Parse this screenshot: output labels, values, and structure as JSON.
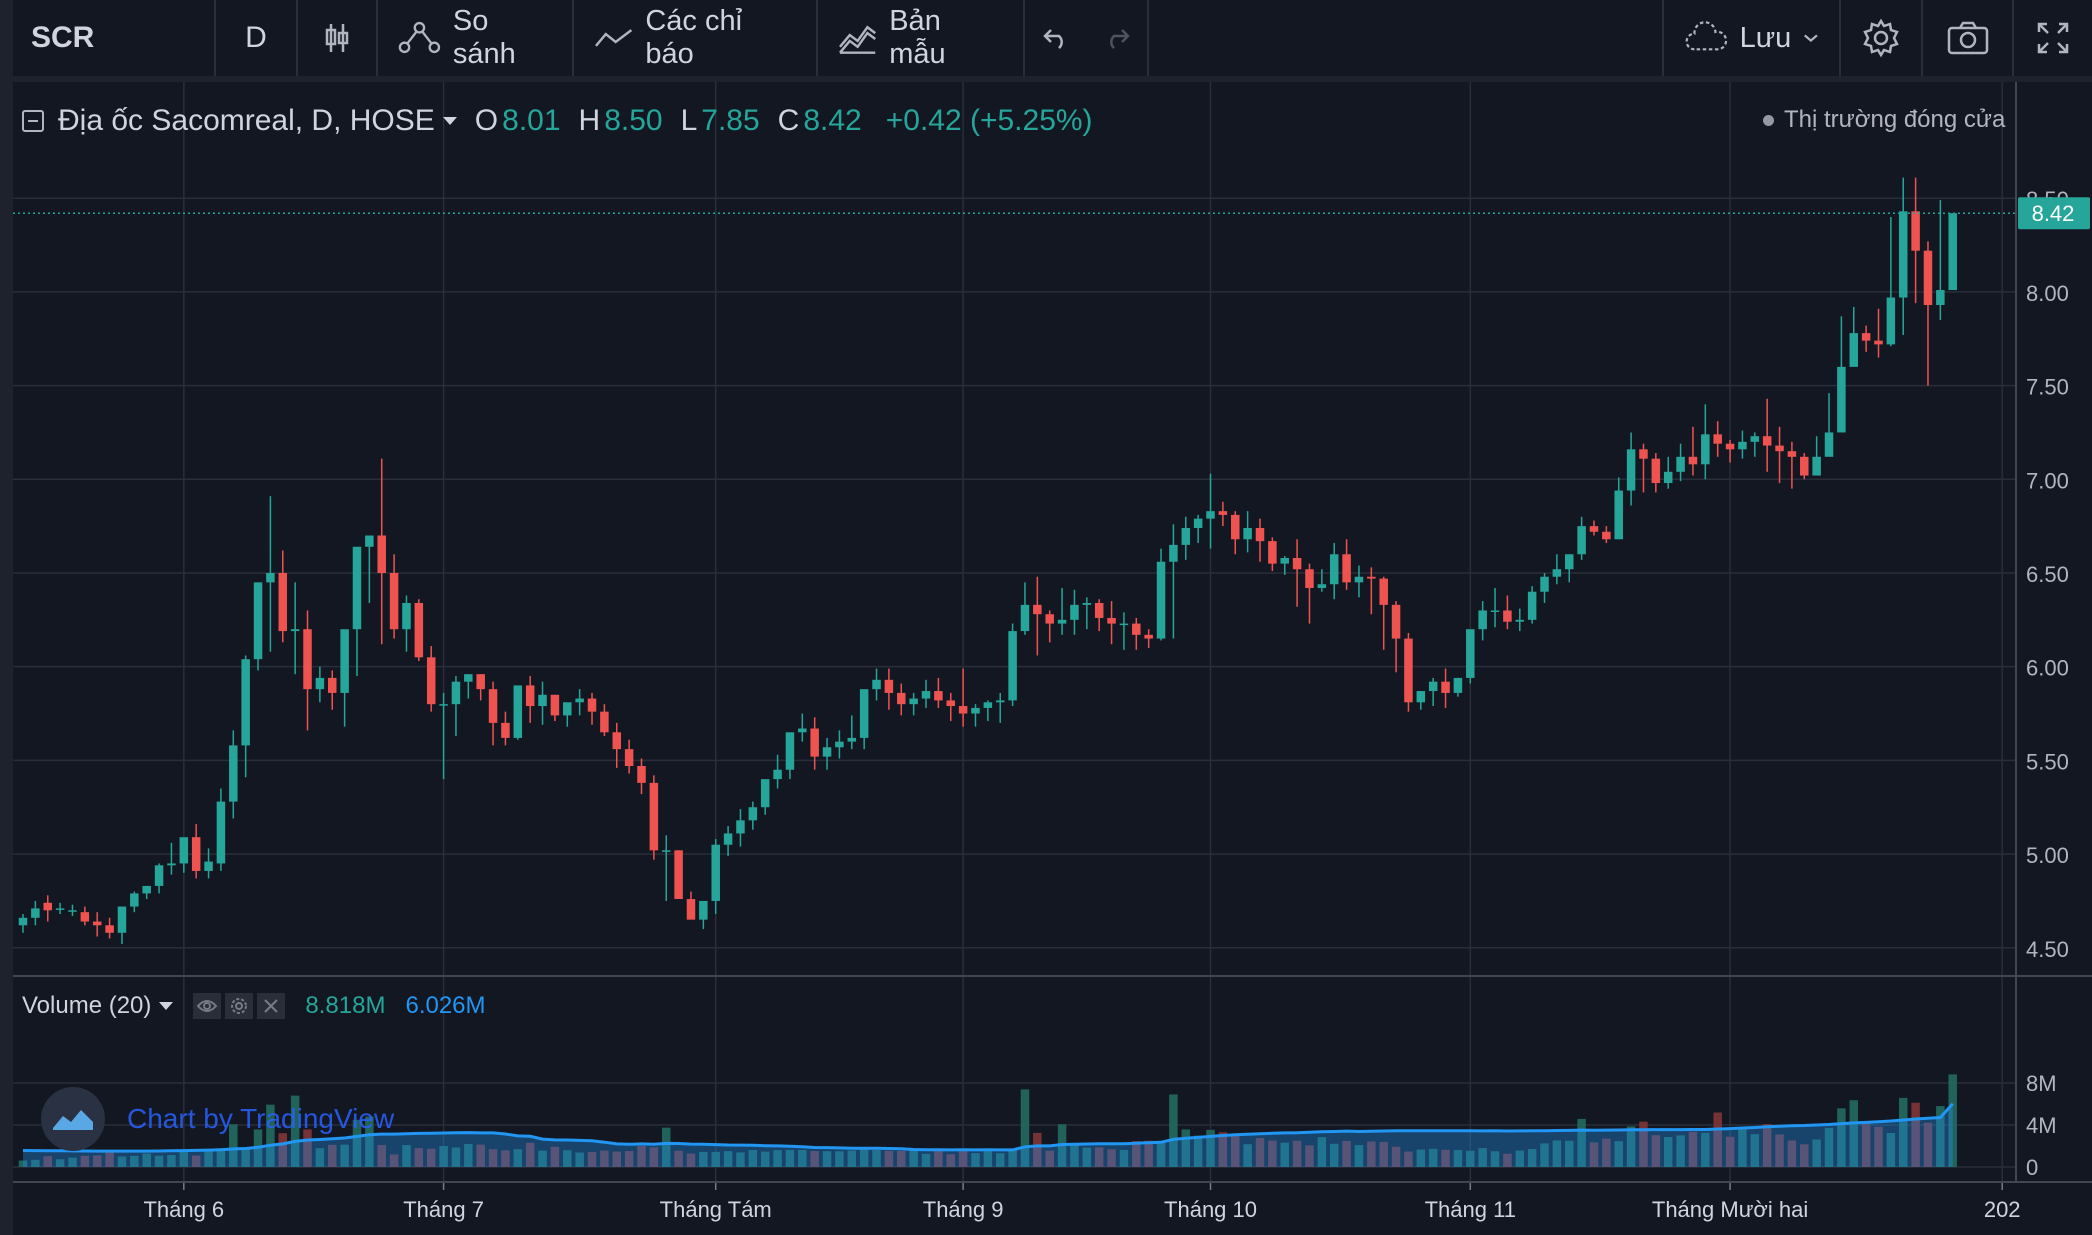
{
  "toolbar": {
    "symbol": "SCR",
    "timeframe": "D",
    "compare_label": "So sánh",
    "indicators_label": "Các chỉ báo",
    "templates_label": "Bản mẫu",
    "save_label": "Lưu",
    "icons": [
      "candles-icon",
      "compare-icon",
      "indicators-icon",
      "templates-icon",
      "undo-icon",
      "redo-icon",
      "cloud-icon",
      "chevron-down-icon",
      "gear-icon",
      "camera-icon",
      "fullscreen-icon"
    ]
  },
  "legend": {
    "title": "Địa ốc Sacomreal, D, HOSE",
    "open_label": "O",
    "open": "8.01",
    "high_label": "H",
    "high": "8.50",
    "low_label": "L",
    "low": "7.85",
    "close_label": "C",
    "close": "8.42",
    "change": "+0.42 (+5.25%)"
  },
  "market_status": "Thị trường đóng cửa",
  "volume_legend": {
    "title": "Volume (20)",
    "value": "8.818M",
    "ma_value": "6.026M"
  },
  "watermark": "Chart by TradingView",
  "colors": {
    "up": "#26a69a",
    "down": "#ef5350",
    "up_vol": "#22675e",
    "down_vol": "#7b3437",
    "ma_line": "#2196f3",
    "background": "#131722",
    "grid": "#2a2e39"
  },
  "chart_data": {
    "type": "candlestick",
    "last_price_label": "8.42",
    "price_ticks": [
      "4.50",
      "5.00",
      "5.50",
      "6.00",
      "6.50",
      "7.00",
      "7.50",
      "8.00",
      "8.50"
    ],
    "volume_ticks": [
      "0",
      "4M",
      "8M"
    ],
    "ylim": [
      4.36,
      8.8
    ],
    "vol_max": 10000000,
    "x_labels": [
      {
        "label": "Tháng 6",
        "index": 13
      },
      {
        "label": "Tháng 7",
        "index": 34
      },
      {
        "label": "Tháng Tám",
        "index": 56
      },
      {
        "label": "Tháng 9",
        "index": 76
      },
      {
        "label": "Tháng 10",
        "index": 96
      },
      {
        "label": "Tháng 11",
        "index": 117
      },
      {
        "label": "Tháng Mười hai",
        "index": 138
      },
      {
        "label": "202",
        "index": 160
      }
    ],
    "series": [
      {
        "name": "Địa ốc Sacomreal",
        "o": [
          4.62,
          4.66,
          4.74,
          4.71,
          4.7,
          4.69,
          4.64,
          4.62,
          4.58,
          4.72,
          4.79,
          4.83,
          4.94,
          4.95,
          5.09,
          4.91,
          4.95,
          5.28,
          5.58,
          6.04,
          6.45,
          6.5,
          6.19,
          6.2,
          5.88,
          5.94,
          5.86,
          6.2,
          6.64,
          6.7,
          6.5,
          6.2,
          6.34,
          6.05,
          5.8,
          5.8,
          5.92,
          5.96,
          5.88,
          5.7,
          5.62,
          5.9,
          5.79,
          5.85,
          5.74,
          5.81,
          5.83,
          5.76,
          5.65,
          5.56,
          5.47,
          5.38,
          5.02,
          5.02,
          4.76,
          4.65,
          4.75,
          5.05,
          5.11,
          5.18,
          5.25,
          5.4,
          5.45,
          5.65,
          5.67,
          5.52,
          5.57,
          5.6,
          5.62,
          5.88,
          5.93,
          5.86,
          5.8,
          5.83,
          5.87,
          5.82,
          5.79,
          5.75,
          5.78,
          5.81,
          5.82,
          6.19,
          6.33,
          6.28,
          6.23,
          6.25,
          6.33,
          6.34,
          6.26,
          6.23,
          6.23,
          6.17,
          6.15,
          6.56,
          6.65,
          6.74,
          6.79,
          6.83,
          6.81,
          6.68,
          6.74,
          6.67,
          6.55,
          6.58,
          6.52,
          6.42,
          6.44,
          6.6,
          6.45,
          6.48,
          6.47,
          6.33,
          6.15,
          5.81,
          5.87,
          5.92,
          5.86,
          5.94,
          6.2,
          6.3,
          6.3,
          6.24,
          6.25,
          6.4,
          6.48,
          6.52,
          6.6,
          6.75,
          6.72,
          6.68,
          6.94,
          7.16,
          7.11,
          6.98,
          7.04,
          7.12,
          7.08,
          7.24,
          7.19,
          7.16,
          7.2,
          7.23,
          7.18,
          7.15,
          7.12,
          7.02,
          7.12,
          7.25,
          7.6,
          7.78,
          7.74,
          7.72,
          7.97,
          8.43,
          8.22,
          7.93,
          8.01
        ],
        "h": [
          4.68,
          4.75,
          4.78,
          4.74,
          4.73,
          4.72,
          4.69,
          4.66,
          4.63,
          4.8,
          4.82,
          4.95,
          5.06,
          5.06,
          5.16,
          5.03,
          5.35,
          5.66,
          6.06,
          6.45,
          6.91,
          6.62,
          6.45,
          6.3,
          6.0,
          5.98,
          5.92,
          6.3,
          6.7,
          7.11,
          6.6,
          6.38,
          6.36,
          6.11,
          5.86,
          5.95,
          5.96,
          5.96,
          5.92,
          5.76,
          5.71,
          5.95,
          5.92,
          5.85,
          5.8,
          5.88,
          5.86,
          5.8,
          5.7,
          5.61,
          5.51,
          5.42,
          5.1,
          5.02,
          4.8,
          4.7,
          5.08,
          5.15,
          5.24,
          5.28,
          5.39,
          5.53,
          5.58,
          5.75,
          5.73,
          5.62,
          5.66,
          5.74,
          5.85,
          5.99,
          5.99,
          5.91,
          5.86,
          5.93,
          5.94,
          5.86,
          5.99,
          5.8,
          5.82,
          5.86,
          6.23,
          6.45,
          6.48,
          6.3,
          6.42,
          6.41,
          6.37,
          6.36,
          6.35,
          6.29,
          6.26,
          6.2,
          6.63,
          6.76,
          6.8,
          6.81,
          7.03,
          6.88,
          6.83,
          6.83,
          6.79,
          6.69,
          6.59,
          6.68,
          6.55,
          6.52,
          6.66,
          6.68,
          6.54,
          6.53,
          6.48,
          6.35,
          6.18,
          5.87,
          5.94,
          5.99,
          5.94,
          6.09,
          6.35,
          6.42,
          6.38,
          6.31,
          6.43,
          6.5,
          6.6,
          6.6,
          6.8,
          6.78,
          6.75,
          7.01,
          7.25,
          7.19,
          7.14,
          7.12,
          7.19,
          7.28,
          7.4,
          7.31,
          7.21,
          7.26,
          7.25,
          7.43,
          7.28,
          7.2,
          7.14,
          7.23,
          7.46,
          7.87,
          7.92,
          7.82,
          7.91,
          8.4,
          8.61,
          8.61,
          8.27,
          8.49
        ],
        "l": [
          4.58,
          4.62,
          4.64,
          4.68,
          4.67,
          4.62,
          4.56,
          4.55,
          4.52,
          4.69,
          4.76,
          4.79,
          4.89,
          4.9,
          4.87,
          4.87,
          4.91,
          5.19,
          5.41,
          5.98,
          6.08,
          6.13,
          5.96,
          5.66,
          5.81,
          5.77,
          5.68,
          5.95,
          6.34,
          6.12,
          6.15,
          6.08,
          6.03,
          5.76,
          5.4,
          5.63,
          5.83,
          5.82,
          5.58,
          5.58,
          5.61,
          5.7,
          5.69,
          5.71,
          5.68,
          5.74,
          5.69,
          5.63,
          5.46,
          5.43,
          5.32,
          4.97,
          4.75,
          4.98,
          4.67,
          4.6,
          4.68,
          4.99,
          5.04,
          5.13,
          5.21,
          5.35,
          5.4,
          5.6,
          5.45,
          5.45,
          5.51,
          5.56,
          5.56,
          5.82,
          5.77,
          5.74,
          5.74,
          5.78,
          5.78,
          5.71,
          5.68,
          5.68,
          5.71,
          5.7,
          5.79,
          6.17,
          6.06,
          6.13,
          6.17,
          6.17,
          6.2,
          6.19,
          6.12,
          6.09,
          6.09,
          6.1,
          6.14,
          6.15,
          6.57,
          6.66,
          6.63,
          6.75,
          6.6,
          6.61,
          6.56,
          6.51,
          6.49,
          6.32,
          6.23,
          6.4,
          6.36,
          6.41,
          6.37,
          6.28,
          6.09,
          5.97,
          5.76,
          5.77,
          5.79,
          5.78,
          5.84,
          5.91,
          6.14,
          6.21,
          6.2,
          6.19,
          6.23,
          6.34,
          6.44,
          6.45,
          6.57,
          6.7,
          6.66,
          6.68,
          6.86,
          6.93,
          6.93,
          6.95,
          6.99,
          7.02,
          7.0,
          7.12,
          7.09,
          7.11,
          7.12,
          7.04,
          6.98,
          6.95,
          7.0,
          7.1,
          7.23,
          7.48,
          7.62,
          7.68,
          7.65,
          7.71,
          7.77,
          7.94,
          7.5,
          7.85
        ],
        "c": [
          4.66,
          4.71,
          4.7,
          4.71,
          4.7,
          4.64,
          4.62,
          4.58,
          4.72,
          4.79,
          4.83,
          4.94,
          4.95,
          5.09,
          4.91,
          4.96,
          5.28,
          5.58,
          6.04,
          6.45,
          6.5,
          6.19,
          6.2,
          5.88,
          5.94,
          5.86,
          6.2,
          6.64,
          6.7,
          6.5,
          6.2,
          6.34,
          6.05,
          5.8,
          5.8,
          5.92,
          5.96,
          5.88,
          5.7,
          5.62,
          5.9,
          5.79,
          5.85,
          5.74,
          5.81,
          5.83,
          5.76,
          5.65,
          5.56,
          5.47,
          5.38,
          5.02,
          5.02,
          4.76,
          4.65,
          4.75,
          5.05,
          5.11,
          5.18,
          5.25,
          5.4,
          5.45,
          5.65,
          5.67,
          5.52,
          5.57,
          5.6,
          5.62,
          5.88,
          5.93,
          5.86,
          5.8,
          5.83,
          5.87,
          5.82,
          5.79,
          5.75,
          5.78,
          5.81,
          5.82,
          6.19,
          6.33,
          6.28,
          6.23,
          6.25,
          6.33,
          6.34,
          6.26,
          6.23,
          6.23,
          6.17,
          6.15,
          6.56,
          6.65,
          6.74,
          6.79,
          6.83,
          6.81,
          6.68,
          6.74,
          6.67,
          6.55,
          6.58,
          6.52,
          6.42,
          6.44,
          6.6,
          6.45,
          6.48,
          6.47,
          6.33,
          6.15,
          5.81,
          5.87,
          5.92,
          5.86,
          5.94,
          6.2,
          6.3,
          6.3,
          6.24,
          6.25,
          6.4,
          6.48,
          6.52,
          6.6,
          6.75,
          6.72,
          6.68,
          6.94,
          7.16,
          7.11,
          6.98,
          7.04,
          7.12,
          7.08,
          7.24,
          7.19,
          7.16,
          7.2,
          7.23,
          7.18,
          7.15,
          7.12,
          7.02,
          7.12,
          7.25,
          7.6,
          7.78,
          7.74,
          7.72,
          7.97,
          8.43,
          8.22,
          7.93,
          8.01,
          8.42
        ],
        "v": [
          620000,
          680000,
          1030000,
          740000,
          890000,
          1070000,
          1110000,
          1550000,
          1000000,
          1060000,
          1280000,
          1080000,
          1140000,
          1450000,
          1090000,
          1600000,
          1790000,
          4070000,
          1700000,
          3580000,
          5940000,
          3220000,
          6800000,
          3580000,
          1790000,
          2110000,
          2130000,
          4490000,
          4810000,
          2090000,
          1200000,
          2090000,
          1800000,
          1740000,
          2000000,
          1860000,
          2190000,
          2130000,
          1700000,
          1590000,
          1700000,
          2310000,
          1560000,
          1920000,
          1600000,
          1380000,
          1430000,
          1570000,
          1470000,
          1520000,
          2000000,
          1880000,
          3750000,
          1550000,
          1280000,
          1440000,
          1440000,
          1510000,
          1390000,
          1620000,
          1470000,
          1610000,
          1630000,
          1620000,
          1520000,
          1510000,
          1500000,
          1560000,
          1710000,
          1610000,
          1540000,
          1530000,
          1620000,
          1260000,
          1600000,
          1220000,
          1660000,
          1330000,
          1590000,
          1310000,
          1760000,
          7390000,
          3250000,
          1550000,
          4070000,
          2190000,
          1850000,
          1870000,
          1690000,
          1630000,
          2470000,
          2500000,
          2380000,
          6910000,
          3580000,
          2990000,
          3540000,
          3310000,
          3000000,
          2170000,
          2750000,
          2510000,
          2320000,
          2500000,
          2060000,
          2850000,
          2210000,
          2480000,
          2090000,
          2430000,
          2390000,
          1930000,
          1470000,
          1660000,
          1730000,
          1640000,
          1620000,
          1540000,
          1800000,
          1500000,
          1260000,
          1560000,
          1710000,
          2250000,
          2530000,
          2500000,
          4580000,
          2350000,
          2700000,
          2460000,
          3870000,
          4320000,
          3030000,
          2860000,
          3010000,
          3360000,
          3260000,
          5190000,
          2880000,
          3600000,
          3130000,
          4090000,
          3100000,
          2530000,
          2160000,
          2620000,
          3730000,
          5590000,
          6360000,
          4140000,
          3830000,
          3240000,
          6580000,
          6120000,
          4220000,
          5800000,
          8818000
        ],
        "ma": [
          1570000,
          1560000,
          1550000,
          1540000,
          1530000,
          1520000,
          1510000,
          1510000,
          1510000,
          1510000,
          1510000,
          1520000,
          1540000,
          1560000,
          1580000,
          1610000,
          1640000,
          1720000,
          1760000,
          1880000,
          2080000,
          2200000,
          2440000,
          2570000,
          2620000,
          2690000,
          2760000,
          2910000,
          3070000,
          3130000,
          3130000,
          3170000,
          3200000,
          3220000,
          3240000,
          3260000,
          3280000,
          3250000,
          3250000,
          3140000,
          2960000,
          2920000,
          2660000,
          2580000,
          2570000,
          2530000,
          2500000,
          2360000,
          2200000,
          2160000,
          2200000,
          2170000,
          2250000,
          2240000,
          2180000,
          2160000,
          2130000,
          2100000,
          2090000,
          2070000,
          2030000,
          2010000,
          1970000,
          1920000,
          1860000,
          1850000,
          1820000,
          1780000,
          1780000,
          1780000,
          1760000,
          1740000,
          1670000,
          1640000,
          1640000,
          1630000,
          1640000,
          1630000,
          1640000,
          1630000,
          1630000,
          1920000,
          2010000,
          2010000,
          2140000,
          2170000,
          2190000,
          2210000,
          2220000,
          2210000,
          2270000,
          2310000,
          2350000,
          2640000,
          2740000,
          2820000,
          2910000,
          3000000,
          3070000,
          3110000,
          3160000,
          3210000,
          3250000,
          3260000,
          3300000,
          3350000,
          3380000,
          3420000,
          3380000,
          3410000,
          3430000,
          3450000,
          3450000,
          3450000,
          3450000,
          3450000,
          3450000,
          3450000,
          3440000,
          3450000,
          3430000,
          3440000,
          3450000,
          3460000,
          3480000,
          3490000,
          3510000,
          3500000,
          3510000,
          3520000,
          3540000,
          3550000,
          3560000,
          3560000,
          3560000,
          3570000,
          3570000,
          3620000,
          3660000,
          3710000,
          3760000,
          3840000,
          3890000,
          3930000,
          3950000,
          4000000,
          4050000,
          4130000,
          4200000,
          4250000,
          4310000,
          4380000,
          4480000,
          4570000,
          4640000,
          4710000,
          6026000
        ]
      }
    ]
  }
}
